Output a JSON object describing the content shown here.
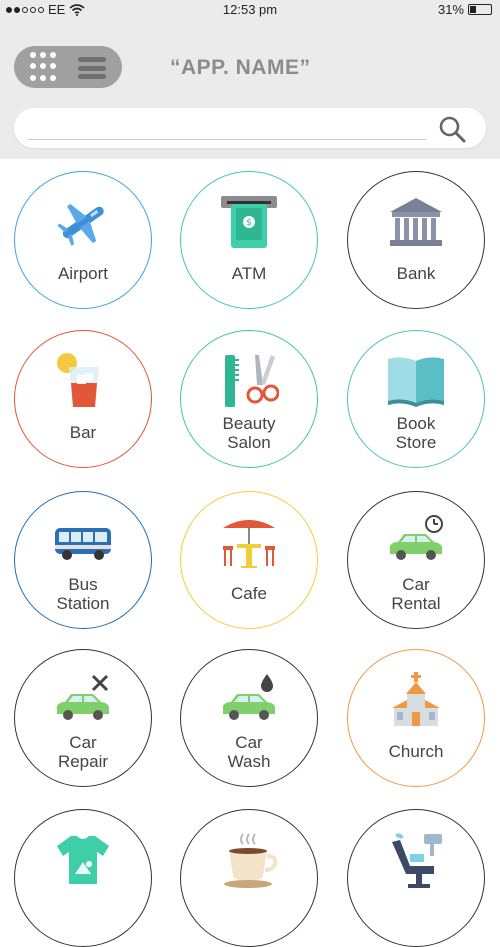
{
  "status_bar": {
    "carrier": "EE",
    "time": "12:53 pm",
    "battery": "31%",
    "battery_level": 0.31,
    "signal_bars": 2
  },
  "header": {
    "app_name": "“APP. NAME”",
    "view_toggle": [
      "grid-icon",
      "list-icon"
    ]
  },
  "search": {
    "placeholder": "",
    "value": "",
    "icon": "search-icon"
  },
  "categories": [
    {
      "label_line1": "Airport",
      "label_line2": "",
      "icon": "airplane-icon",
      "border_color": "#3fa2dc"
    },
    {
      "label_line1": "ATM",
      "label_line2": "",
      "icon": "atm-icon",
      "border_color": "#3ec9b0"
    },
    {
      "label_line1": "Bank",
      "label_line2": "",
      "icon": "bank-icon",
      "border_color": "#333333"
    },
    {
      "label_line1": "Bar",
      "label_line2": "",
      "icon": "cocktail-icon",
      "border_color": "#e2563a"
    },
    {
      "label_line1": "Beauty",
      "label_line2": "Salon",
      "icon": "comb-scissors-icon",
      "border_color": "#3ec9a0"
    },
    {
      "label_line1": "Book",
      "label_line2": "Store",
      "icon": "book-icon",
      "border_color": "#4fc0c0"
    },
    {
      "label_line1": "Bus",
      "label_line2": "Station",
      "icon": "bus-icon",
      "border_color": "#1f6fb5"
    },
    {
      "label_line1": "Cafe",
      "label_line2": "",
      "icon": "cafe-table-icon",
      "border_color": "#f2cd3a"
    },
    {
      "label_line1": "Car",
      "label_line2": "Rental",
      "icon": "car-clock-icon",
      "border_color": "#333333"
    },
    {
      "label_line1": "Car",
      "label_line2": "Repair",
      "icon": "car-tools-icon",
      "border_color": "#333333"
    },
    {
      "label_line1": "Car",
      "label_line2": "Wash",
      "icon": "car-drop-icon",
      "border_color": "#333333"
    },
    {
      "label_line1": "Church",
      "label_line2": "",
      "icon": "church-icon",
      "border_color": "#ee9a44"
    },
    {
      "label_line1": "",
      "label_line2": "",
      "icon": "tshirt-icon",
      "border_color": "#333333"
    },
    {
      "label_line1": "",
      "label_line2": "",
      "icon": "coffee-cup-icon",
      "border_color": "#333333"
    },
    {
      "label_line1": "",
      "label_line2": "",
      "icon": "dentist-chair-icon",
      "border_color": "#333333"
    }
  ]
}
